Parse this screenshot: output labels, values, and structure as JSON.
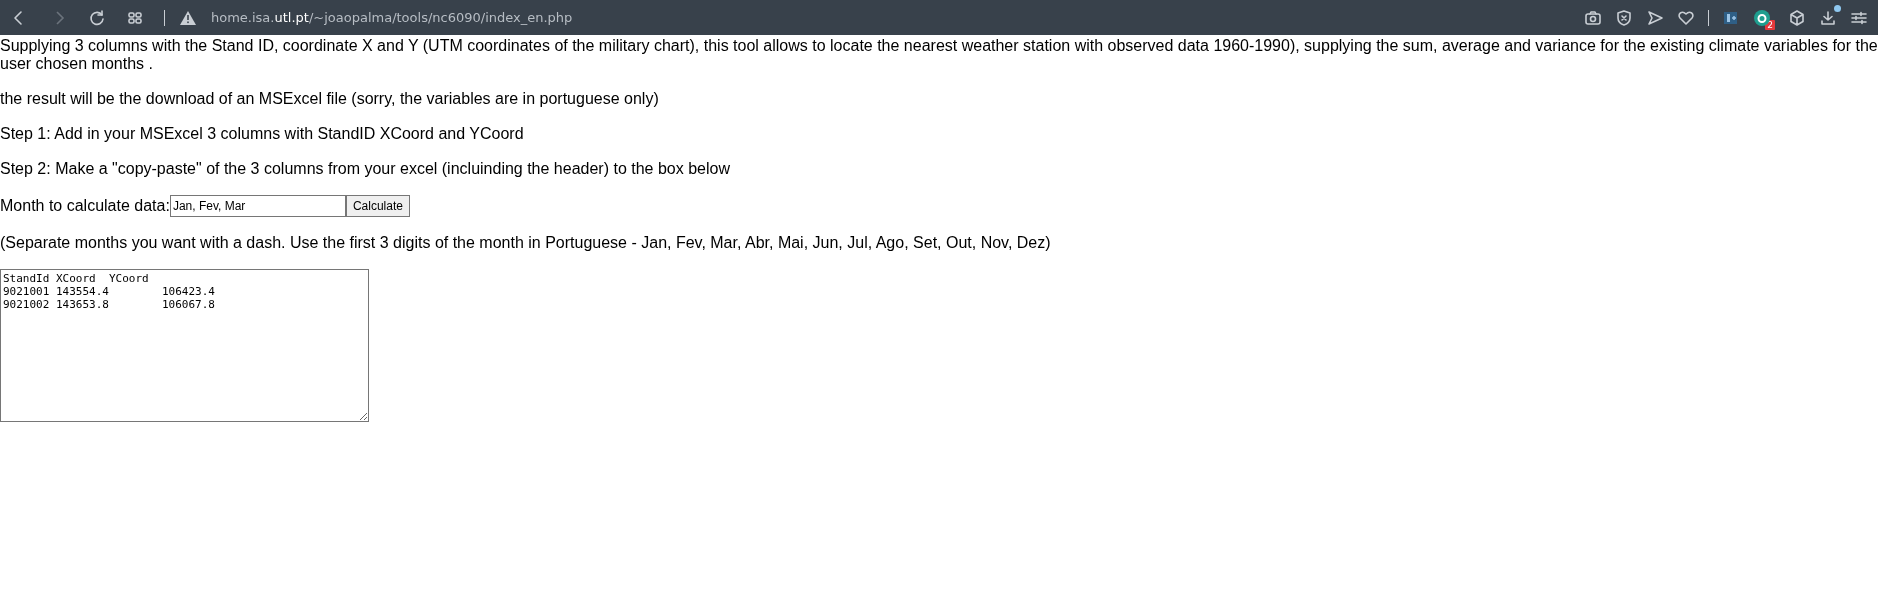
{
  "browser": {
    "url_host": "home.isa.",
    "url_domain": "utl.pt",
    "url_path": "/~joaopalma/tools/nc6090/index_en.php",
    "extension_badge": "2",
    "download_dot": true
  },
  "page": {
    "paragraphs": [
      "Supplying 3 columns with the Stand ID, coordinate X and Y (UTM coordinates of the military chart), this tool allows to locate the nearest weather station with observed data 1960-1990), supplying the sum, average and variance for the existing climate variables for the user chosen months .",
      "the result will be the download of an MSExcel file (sorry, the variables are in portuguese only)",
      "Step 1: Add in your MSExcel 3 columns with StandID XCoord and YCoord",
      "Step 2: Make a \"copy-paste\" of the 3 columns from your excel (incluinding the header) to the box below"
    ],
    "month_label": "Month to calculate data:",
    "month_value": "Jan, Fev, Mar",
    "calculate_button": "Calculate",
    "note": "(Separate months you want with a dash. Use the first 3 digits of the month in Portuguese - Jan, Fev, Mar, Abr, Mai, Jun, Jul, Ago, Set, Out, Nov, Dez)",
    "data_box": "StandId XCoord  YCoord\n9021001 143554.4\t106423.4\n9021002 143653.8\t106067.8"
  }
}
